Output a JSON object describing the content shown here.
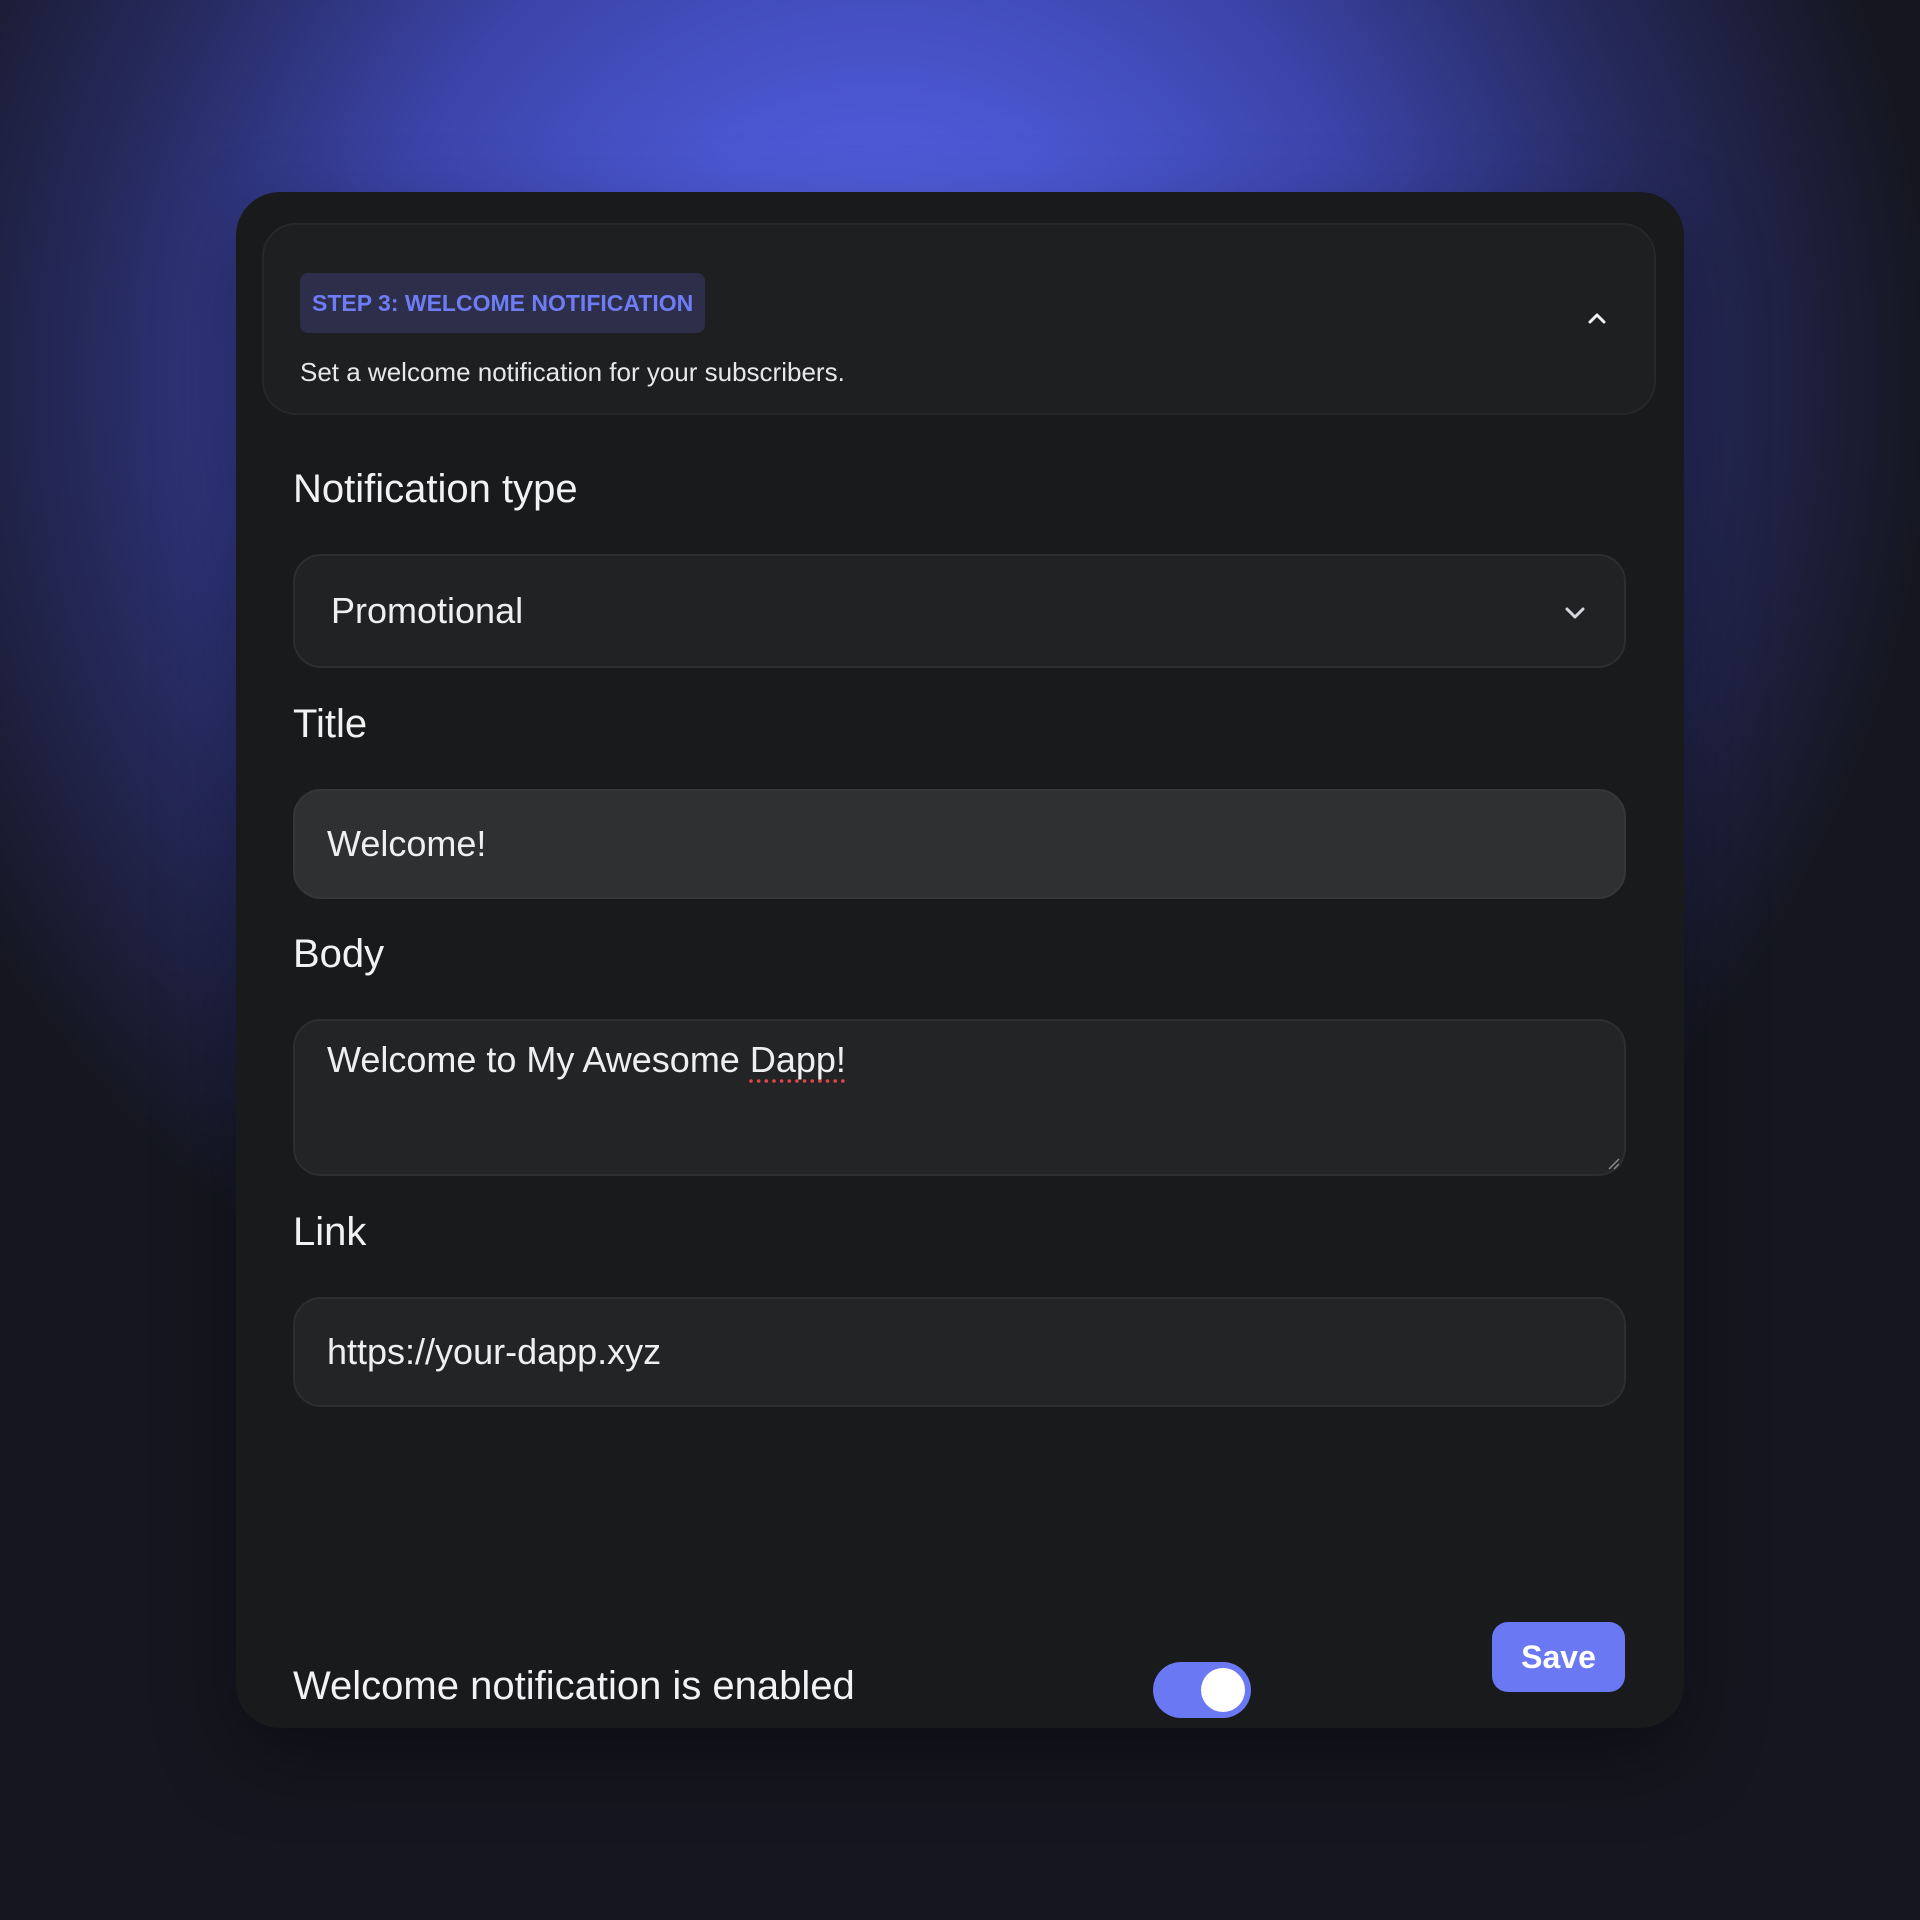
{
  "step": {
    "badge": "STEP 3: WELCOME NOTIFICATION",
    "description": "Set a welcome notification for your subscribers.",
    "collapse_icon": "chevron-up-icon"
  },
  "fields": {
    "notification_type": {
      "label": "Notification type",
      "selected": "Promotional",
      "icon": "chevron-down-icon"
    },
    "title": {
      "label": "Title",
      "value": "Welcome!"
    },
    "body": {
      "label": "Body",
      "value_prefix": "Welcome to My Awesome ",
      "value_flagged": "Dapp!"
    },
    "link": {
      "label": "Link",
      "value": "https://your-dapp.xyz"
    }
  },
  "toggle": {
    "label": "Welcome notification is enabled",
    "enabled": true
  },
  "actions": {
    "save_label": "Save"
  },
  "colors": {
    "accent": "#6a78f4",
    "card_background": "#191a1b",
    "badge_background": "#2c2e4a"
  }
}
